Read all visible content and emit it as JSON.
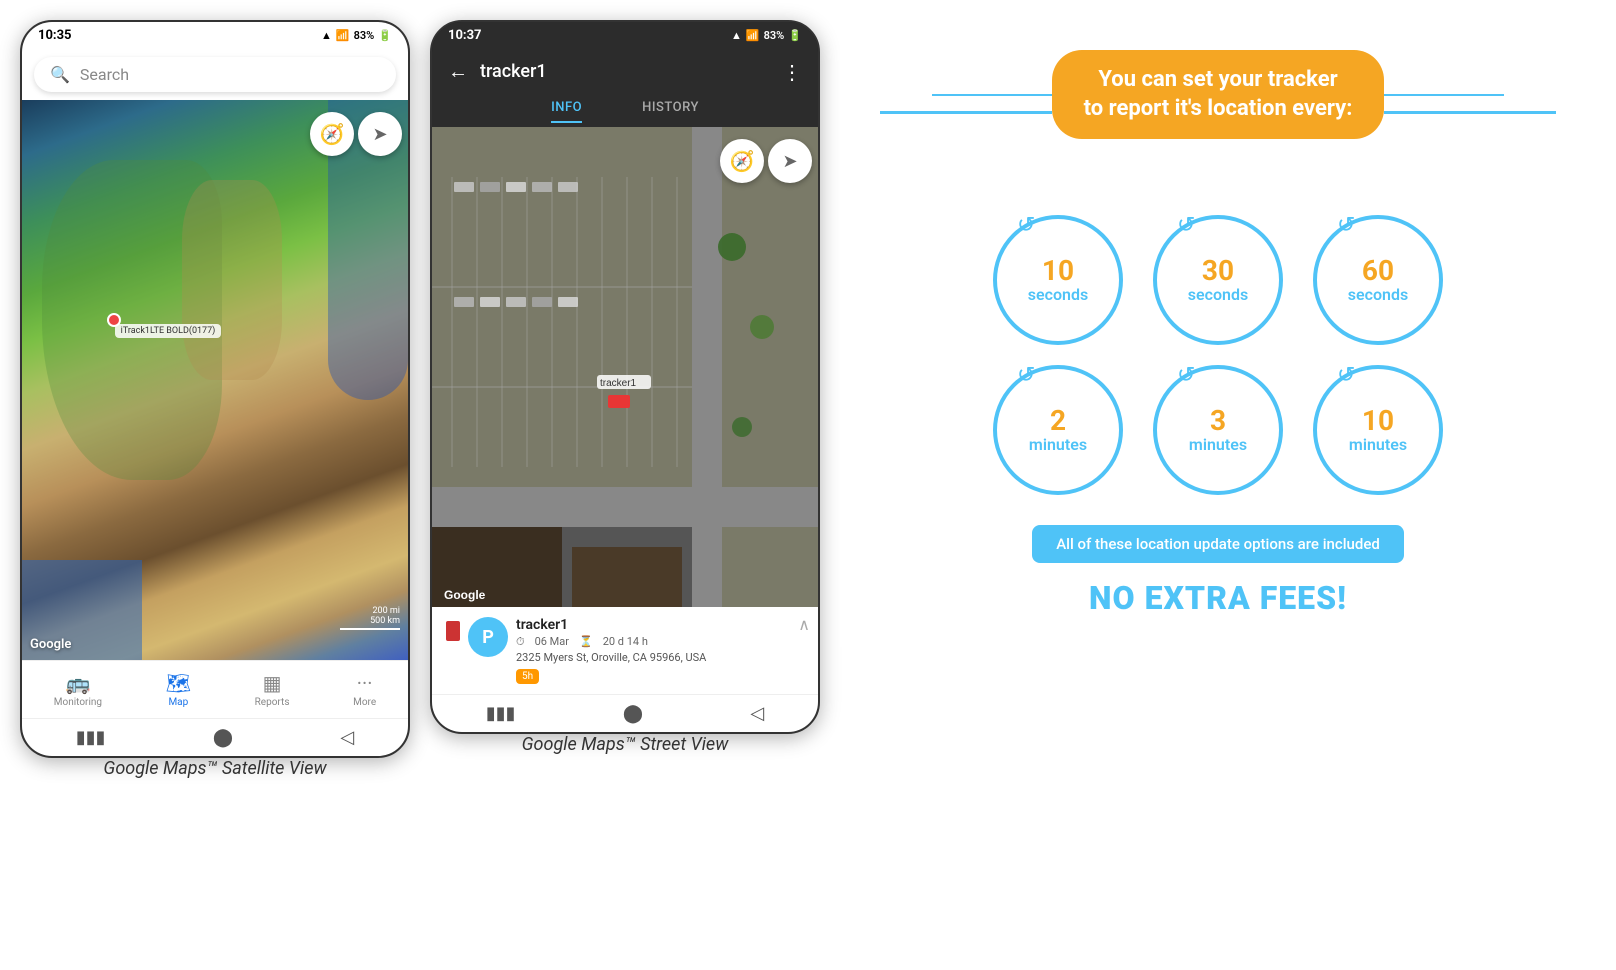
{
  "phone1": {
    "status_bar": {
      "time": "10:35",
      "signal": "▲▼",
      "wifi": "WiFi",
      "battery": "83%"
    },
    "search": {
      "placeholder": "Search"
    },
    "map": {
      "google_watermark": "Google",
      "scale_200mi": "200 mi",
      "scale_500km": "500 km",
      "pin_label": "iTrack1LTE BOLD(0177)"
    },
    "bottom_nav": [
      {
        "id": "monitoring",
        "label": "Monitoring",
        "icon": "🚌"
      },
      {
        "id": "map",
        "label": "Map",
        "icon": "🗺",
        "active": true
      },
      {
        "id": "reports",
        "label": "Reports",
        "icon": "⊞"
      },
      {
        "id": "more",
        "label": "More",
        "icon": "···"
      }
    ],
    "caption": "Google Maps™ Satellite View"
  },
  "phone2": {
    "status_bar": {
      "time": "10:37",
      "battery": "83%"
    },
    "header": {
      "back_icon": "←",
      "title": "tracker1",
      "menu_icon": "⋮"
    },
    "tabs": [
      {
        "id": "info",
        "label": "INFO",
        "active": true
      },
      {
        "id": "history",
        "label": "HISTORY",
        "active": false
      }
    ],
    "map": {
      "google_watermark": "Google",
      "tracker_label": "tracker1"
    },
    "tracker_info": {
      "avatar_letter": "P",
      "name": "tracker1",
      "date": "06 Mar",
      "duration": "20 d 14 h",
      "address": "2325 Myers St, Oroville, CA 95966, USA",
      "time_badge": "5h"
    },
    "caption": "Google Maps™ Street View"
  },
  "info_panel": {
    "headline": "You can set your tracker\nto report it's location every:",
    "circles": [
      {
        "number": "10",
        "unit": "seconds"
      },
      {
        "number": "30",
        "unit": "seconds"
      },
      {
        "number": "60",
        "unit": "seconds"
      },
      {
        "number": "2",
        "unit": "minutes"
      },
      {
        "number": "3",
        "unit": "minutes"
      },
      {
        "number": "10",
        "unit": "minutes"
      }
    ],
    "banner_text": "All of these location update options are included",
    "no_fees_text": "NO EXTRA FEES!",
    "accent_color": "#f5a623",
    "blue_color": "#4fc3f7"
  }
}
